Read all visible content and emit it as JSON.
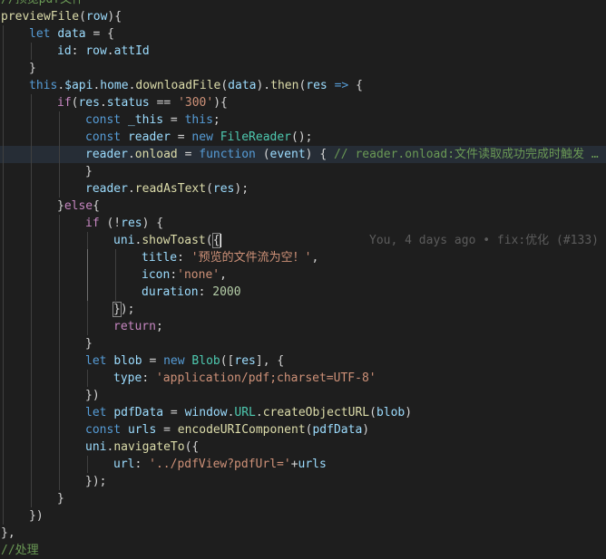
{
  "editor": {
    "background": "#1e1e1e",
    "highlight_line": 9,
    "cursor_line": 14,
    "blame": "You, 4 days ago • fix:优化 (#133)",
    "lines": [
      {
        "indent": 0,
        "tokens": [
          [
            "cmt",
            "//预览pdf文件"
          ]
        ]
      },
      {
        "indent": 0,
        "tokens": [
          [
            "fn",
            "previewFile"
          ],
          [
            "pun",
            "("
          ],
          [
            "var",
            "row"
          ],
          [
            "pun",
            "){"
          ]
        ]
      },
      {
        "indent": 1,
        "tokens": [
          [
            "kw",
            "let "
          ],
          [
            "var",
            "data"
          ],
          [
            "pun",
            " = {"
          ]
        ]
      },
      {
        "indent": 2,
        "tokens": [
          [
            "var",
            "id"
          ],
          [
            "pun",
            ": "
          ],
          [
            "var",
            "row"
          ],
          [
            "pun",
            "."
          ],
          [
            "var",
            "attId"
          ]
        ]
      },
      {
        "indent": 1,
        "tokens": [
          [
            "pun",
            "}"
          ]
        ]
      },
      {
        "indent": 1,
        "tokens": [
          [
            "kw",
            "this"
          ],
          [
            "pun",
            "."
          ],
          [
            "var",
            "$api"
          ],
          [
            "pun",
            "."
          ],
          [
            "var",
            "home"
          ],
          [
            "pun",
            "."
          ],
          [
            "fn",
            "downloadFile"
          ],
          [
            "pun",
            "("
          ],
          [
            "var",
            "data"
          ],
          [
            "pun",
            ")."
          ],
          [
            "fn",
            "then"
          ],
          [
            "pun",
            "("
          ],
          [
            "var",
            "res"
          ],
          [
            "pun",
            " "
          ],
          [
            "kw",
            "=>"
          ],
          [
            "pun",
            " {"
          ]
        ]
      },
      {
        "indent": 2,
        "tokens": [
          [
            "ctl",
            "if"
          ],
          [
            "pun",
            "("
          ],
          [
            "var",
            "res"
          ],
          [
            "pun",
            "."
          ],
          [
            "var",
            "status"
          ],
          [
            "pun",
            " == "
          ],
          [
            "str",
            "'300'"
          ],
          [
            "pun",
            "){"
          ]
        ]
      },
      {
        "indent": 3,
        "tokens": [
          [
            "kw",
            "const "
          ],
          [
            "var",
            "_this"
          ],
          [
            "pun",
            " = "
          ],
          [
            "kw",
            "this"
          ],
          [
            "pun",
            ";"
          ]
        ]
      },
      {
        "indent": 3,
        "tokens": [
          [
            "kw",
            "const "
          ],
          [
            "var",
            "reader"
          ],
          [
            "pun",
            " = "
          ],
          [
            "kw",
            "new "
          ],
          [
            "cls",
            "FileReader"
          ],
          [
            "pun",
            "();"
          ]
        ]
      },
      {
        "indent": 3,
        "tokens": [
          [
            "var",
            "reader"
          ],
          [
            "pun",
            "."
          ],
          [
            "fn",
            "onload"
          ],
          [
            "pun",
            " = "
          ],
          [
            "kw",
            "function"
          ],
          [
            "pun",
            " ("
          ],
          [
            "var",
            "event"
          ],
          [
            "pun",
            ") { "
          ],
          [
            "cmt",
            "// reader.onload:文件读取成功完成时触发 …"
          ]
        ]
      },
      {
        "indent": 3,
        "tokens": [
          [
            "pun",
            "}"
          ]
        ]
      },
      {
        "indent": 3,
        "tokens": [
          [
            "var",
            "reader"
          ],
          [
            "pun",
            "."
          ],
          [
            "fn",
            "readAsText"
          ],
          [
            "pun",
            "("
          ],
          [
            "var",
            "res"
          ],
          [
            "pun",
            ");"
          ]
        ]
      },
      {
        "indent": 2,
        "tokens": [
          [
            "pun",
            "}"
          ],
          [
            "ctl",
            "else"
          ],
          [
            "pun",
            "{"
          ]
        ]
      },
      {
        "indent": 3,
        "tokens": [
          [
            "ctl",
            "if"
          ],
          [
            "pun",
            " (!"
          ],
          [
            "var",
            "res"
          ],
          [
            "pun",
            ") {"
          ]
        ]
      },
      {
        "indent": 4,
        "tokens": [
          [
            "var",
            "uni"
          ],
          [
            "pun",
            "."
          ],
          [
            "fn",
            "showToast"
          ],
          [
            "pun",
            "("
          ],
          [
            "pun",
            "{"
          ]
        ]
      },
      {
        "indent": 5,
        "tokens": [
          [
            "var",
            "title"
          ],
          [
            "pun",
            ": "
          ],
          [
            "str",
            "'预览的文件流为空！'"
          ],
          [
            "pun",
            ","
          ]
        ]
      },
      {
        "indent": 5,
        "tokens": [
          [
            "var",
            "icon"
          ],
          [
            "pun",
            ":"
          ],
          [
            "str",
            "'none'"
          ],
          [
            "pun",
            ","
          ]
        ]
      },
      {
        "indent": 5,
        "tokens": [
          [
            "var",
            "duration"
          ],
          [
            "pun",
            ": "
          ],
          [
            "num",
            "2000"
          ]
        ]
      },
      {
        "indent": 4,
        "tokens": [
          [
            "pun",
            "}"
          ],
          [
            "pun",
            ");"
          ]
        ]
      },
      {
        "indent": 4,
        "tokens": [
          [
            "ctl",
            "return"
          ],
          [
            "pun",
            ";"
          ]
        ]
      },
      {
        "indent": 3,
        "tokens": [
          [
            "pun",
            "}"
          ]
        ]
      },
      {
        "indent": 3,
        "tokens": [
          [
            "kw",
            "let "
          ],
          [
            "var",
            "blob"
          ],
          [
            "pun",
            " = "
          ],
          [
            "kw",
            "new "
          ],
          [
            "cls",
            "Blob"
          ],
          [
            "pun",
            "(["
          ],
          [
            "var",
            "res"
          ],
          [
            "pun",
            "], {"
          ]
        ]
      },
      {
        "indent": 4,
        "tokens": [
          [
            "var",
            "type"
          ],
          [
            "pun",
            ": "
          ],
          [
            "str",
            "'application/pdf;charset=UTF-8'"
          ]
        ]
      },
      {
        "indent": 3,
        "tokens": [
          [
            "pun",
            "})"
          ]
        ]
      },
      {
        "indent": 3,
        "tokens": [
          [
            "kw",
            "let "
          ],
          [
            "var",
            "pdfData"
          ],
          [
            "pun",
            " = "
          ],
          [
            "var",
            "window"
          ],
          [
            "pun",
            "."
          ],
          [
            "cls",
            "URL"
          ],
          [
            "pun",
            "."
          ],
          [
            "fn",
            "createObjectURL"
          ],
          [
            "pun",
            "("
          ],
          [
            "var",
            "blob"
          ],
          [
            "pun",
            ")"
          ]
        ]
      },
      {
        "indent": 3,
        "tokens": [
          [
            "kw",
            "const "
          ],
          [
            "var",
            "urls"
          ],
          [
            "pun",
            " = "
          ],
          [
            "fn",
            "encodeURIComponent"
          ],
          [
            "pun",
            "("
          ],
          [
            "var",
            "pdfData"
          ],
          [
            "pun",
            ")"
          ]
        ]
      },
      {
        "indent": 3,
        "tokens": [
          [
            "var",
            "uni"
          ],
          [
            "pun",
            "."
          ],
          [
            "fn",
            "navigateTo"
          ],
          [
            "pun",
            "({"
          ]
        ]
      },
      {
        "indent": 4,
        "tokens": [
          [
            "var",
            "url"
          ],
          [
            "pun",
            ": "
          ],
          [
            "str",
            "'../pdfView?pdfUrl='"
          ],
          [
            "pun",
            "+"
          ],
          [
            "var",
            "urls"
          ]
        ]
      },
      {
        "indent": 3,
        "tokens": [
          [
            "pun",
            "});"
          ]
        ]
      },
      {
        "indent": 2,
        "tokens": [
          [
            "pun",
            "}"
          ]
        ]
      },
      {
        "indent": 1,
        "tokens": [
          [
            "pun",
            "})"
          ]
        ]
      },
      {
        "indent": 0,
        "tokens": [
          [
            "pun",
            "},"
          ]
        ]
      },
      {
        "indent": 0,
        "tokens": [
          [
            "cmt",
            "//处理"
          ]
        ]
      }
    ]
  }
}
